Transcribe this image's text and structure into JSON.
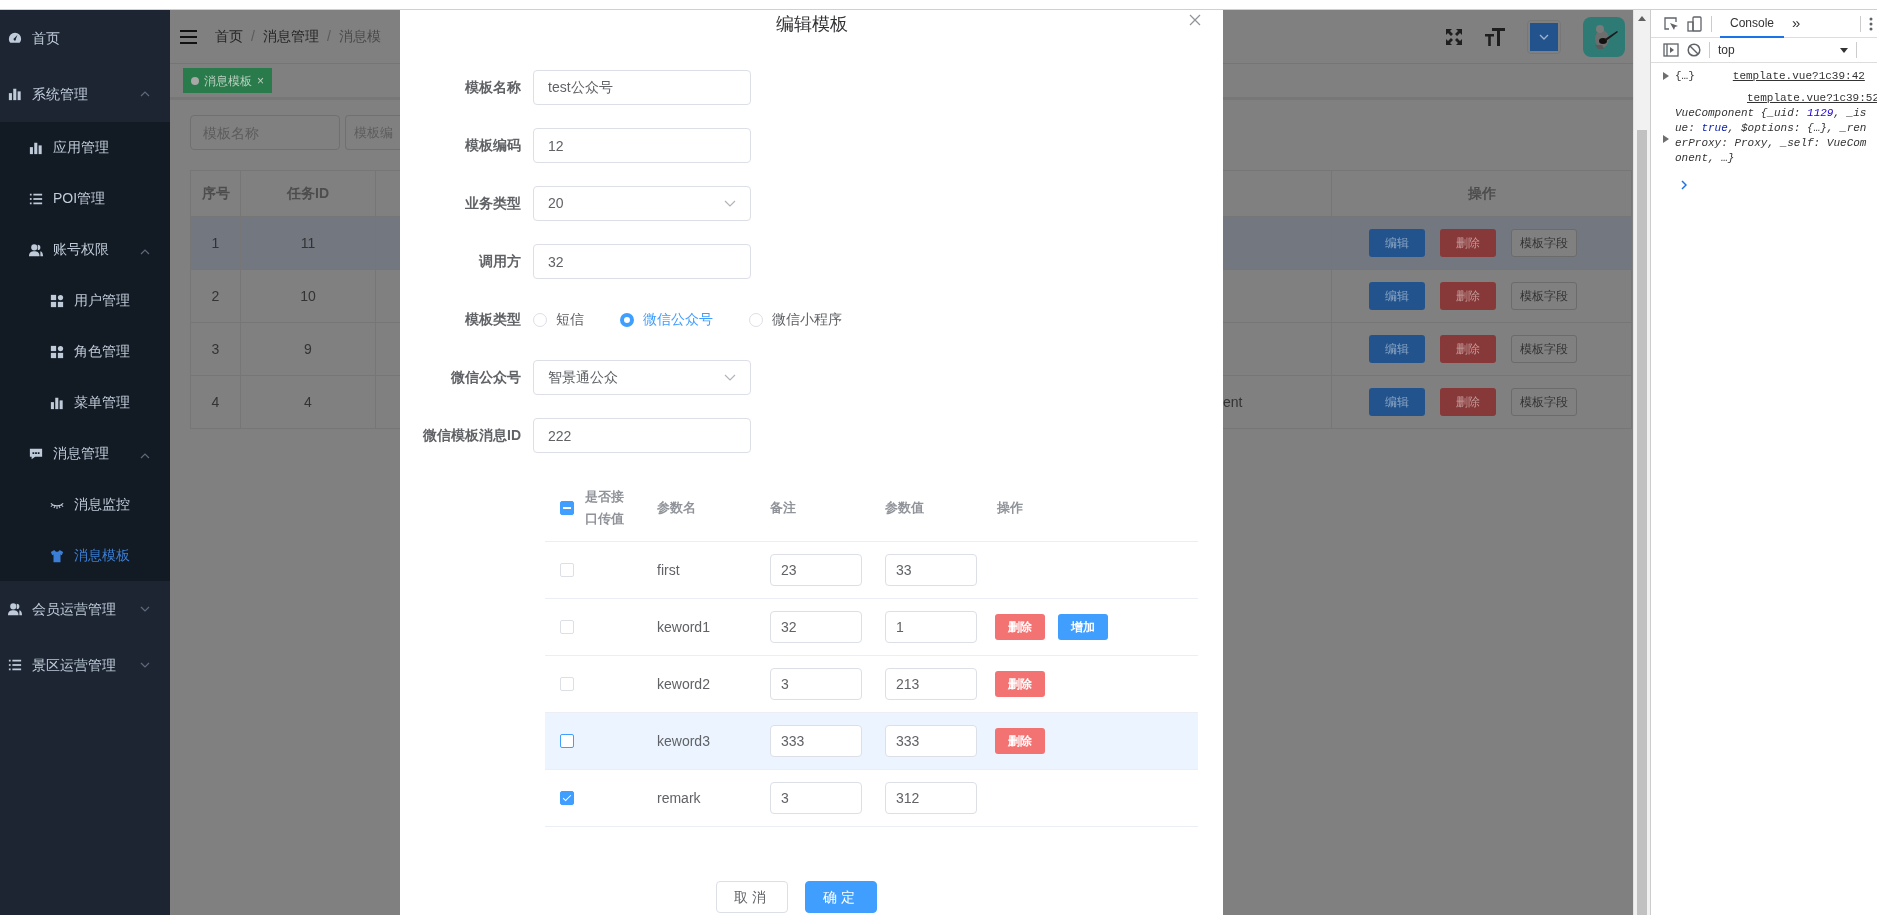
{
  "sidebar": {
    "items": [
      {
        "label": "首页",
        "selected": false
      },
      {
        "label": "系统管理",
        "selected": false,
        "expanded": true,
        "children": [
          {
            "label": "应用管理",
            "selected": false
          },
          {
            "label": "POI管理",
            "selected": false
          },
          {
            "label": "账号权限",
            "selected": false,
            "expanded": true,
            "children": [
              {
                "label": "用户管理",
                "selected": false
              },
              {
                "label": "角色管理",
                "selected": false
              },
              {
                "label": "菜单管理",
                "selected": false
              }
            ]
          },
          {
            "label": "消息管理",
            "selected": false,
            "expanded": true,
            "children": [
              {
                "label": "消息监控",
                "selected": false
              },
              {
                "label": "消息模板",
                "selected": true
              }
            ]
          }
        ]
      },
      {
        "label": "会员运营管理",
        "selected": false,
        "expanded": false
      },
      {
        "label": "景区运营管理",
        "selected": false,
        "expanded": false
      }
    ]
  },
  "header": {
    "breadcrumb": [
      "首页",
      "消息管理",
      "消息模"
    ],
    "separator": "/"
  },
  "tags": [
    {
      "label": "消息模板",
      "selected": true,
      "close": "×"
    }
  ],
  "search_fields": [
    {
      "placeholder": "模板名称"
    },
    {
      "placeholder": "模板编"
    }
  ],
  "table": {
    "columns": [
      "序号",
      "任务ID",
      "操作"
    ],
    "rows": [
      {
        "index": "1",
        "task_id": "11",
        "selected": true,
        "actions": [
          {
            "label": "编辑",
            "kind": "primary"
          },
          {
            "label": "删除",
            "kind": "danger"
          },
          {
            "label": "模板字段",
            "kind": "default"
          }
        ]
      },
      {
        "index": "2",
        "task_id": "10",
        "selected": false,
        "actions": [
          {
            "label": "编辑",
            "kind": "primary"
          },
          {
            "label": "删除",
            "kind": "danger"
          },
          {
            "label": "模板字段",
            "kind": "default"
          }
        ]
      },
      {
        "index": "3",
        "task_id": "9",
        "selected": false,
        "actions": [
          {
            "label": "编辑",
            "kind": "primary"
          },
          {
            "label": "删除",
            "kind": "danger"
          },
          {
            "label": "模板字段",
            "kind": "default"
          }
        ]
      },
      {
        "index": "4",
        "task_id": "4",
        "column_3": "ent",
        "selected": false,
        "actions": [
          {
            "label": "编辑",
            "kind": "primary"
          },
          {
            "label": "删除",
            "kind": "danger"
          },
          {
            "label": "模板字段",
            "kind": "default"
          }
        ]
      }
    ]
  },
  "dialog": {
    "title": "编辑模板",
    "fields": [
      {
        "label": "模板名称",
        "kind": "text",
        "value": "test公众号"
      },
      {
        "label": "模板编码",
        "kind": "text",
        "value": "12"
      },
      {
        "label": "业务类型",
        "kind": "select",
        "value": "20"
      },
      {
        "label": "调用方",
        "kind": "text",
        "value": "32"
      },
      {
        "label": "模板类型",
        "kind": "radio",
        "options": [
          {
            "label": "短信",
            "selected": false
          },
          {
            "label": "微信公众号",
            "selected": true
          },
          {
            "label": "微信小程序",
            "selected": false
          }
        ]
      },
      {
        "label": "微信公众号",
        "kind": "select",
        "value": "智景通公众"
      },
      {
        "label": "微信模板消息ID",
        "kind": "text",
        "value": "222"
      }
    ],
    "params": {
      "columns": [
        "是否接口传值",
        "参数名",
        "备注",
        "参数值",
        "操作"
      ],
      "select_all": {
        "indeterminate": true
      },
      "rows": [
        {
          "name": "first",
          "note": "23",
          "value": "33",
          "checked": false,
          "hovered": false
        },
        {
          "name": "keword1",
          "note": "32",
          "value": "1",
          "checked": false,
          "hovered": false,
          "actions": [
            {
              "label": "删除",
              "kind": "danger"
            },
            {
              "label": "增加",
              "kind": "primary"
            }
          ]
        },
        {
          "name": "keword2",
          "note": "3",
          "value": "213",
          "checked": false,
          "hovered": false,
          "actions": [
            {
              "label": "删除",
              "kind": "danger"
            }
          ]
        },
        {
          "name": "keword3",
          "note": "333",
          "value": "333",
          "checked": false,
          "hovered": true,
          "actions": [
            {
              "label": "删除",
              "kind": "danger"
            }
          ]
        },
        {
          "name": "remark",
          "note": "3",
          "value": "312",
          "checked": true,
          "hovered": false
        }
      ]
    },
    "buttons": [
      {
        "label": "取消",
        "kind": "default"
      },
      {
        "label": "确定",
        "kind": "primary"
      }
    ]
  },
  "devtools": {
    "tabs": [
      {
        "label": "Console",
        "selected": true
      }
    ],
    "more": "»",
    "context": "top",
    "log": [
      {
        "summary": "{…}",
        "source": "template.vue?1c39:42"
      },
      {
        "source": "template.vue?1c39:52",
        "lines": [
          [
            {
              "text": "VueComponent {_uid: "
            },
            {
              "text": "1129",
              "kind": "number"
            },
            {
              "text": ", _is"
            }
          ],
          [
            {
              "text": "ue: "
            },
            {
              "text": "true",
              "kind": "keyword"
            },
            {
              "text": ", $options: {…}, _ren"
            }
          ],
          [
            {
              "text": "erProxy: Proxy, _self: VueCom"
            }
          ],
          [
            {
              "text": "onent, …}"
            }
          ]
        ]
      }
    ]
  }
}
